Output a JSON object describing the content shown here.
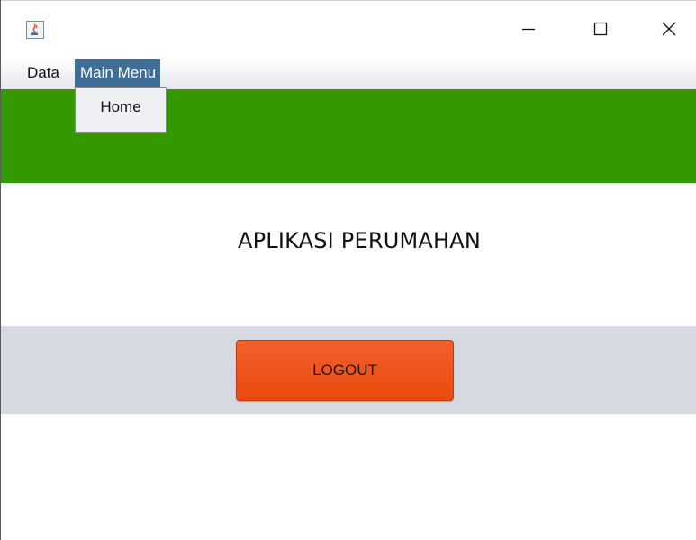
{
  "window": {
    "app_icon": "java-coffee-icon",
    "controls": {
      "minimize_icon": "minimize-icon",
      "maximize_icon": "maximize-icon",
      "close_icon": "close-icon"
    }
  },
  "menubar": {
    "items": [
      {
        "label": "Data"
      },
      {
        "label": "Main Menu",
        "open": true
      }
    ]
  },
  "dropdown": {
    "items": [
      {
        "label": "Home"
      }
    ]
  },
  "main": {
    "title": "APLIKASI PERUMAHAN",
    "logout_label": "LOGOUT"
  },
  "colors": {
    "header_band": "#339900",
    "button_band": "#d6d9df",
    "logout_button": "#ef5518",
    "menu_highlight": "#3e6e97"
  }
}
